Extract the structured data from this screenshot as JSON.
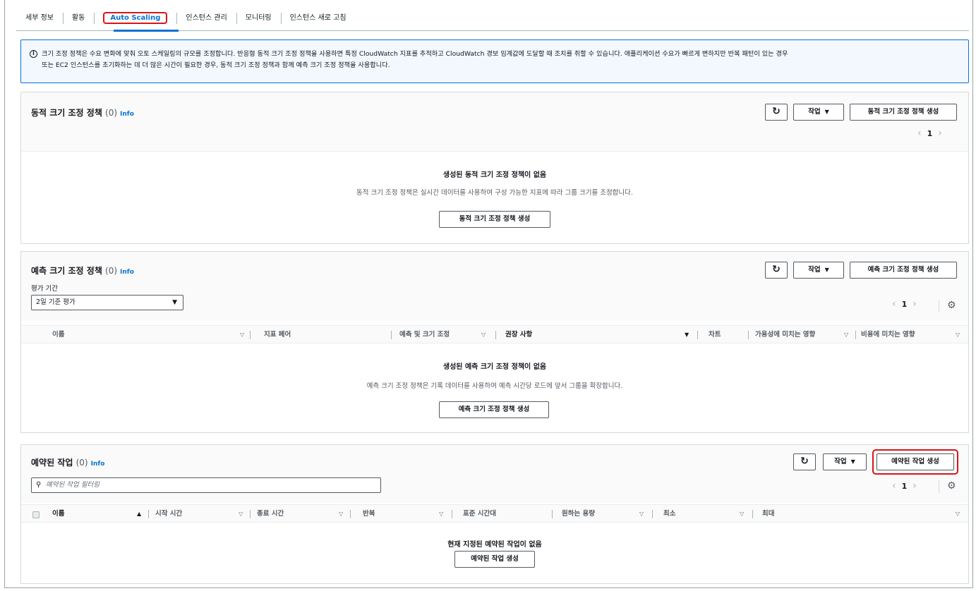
{
  "tabs": [
    {
      "label": "세부 정보"
    },
    {
      "label": "활동"
    },
    {
      "label": "Auto Scaling"
    },
    {
      "label": "인스턴스 관리"
    },
    {
      "label": "모니터링"
    },
    {
      "label": "인스턴스 새로 고침"
    }
  ],
  "alert": {
    "icon": "info-icon",
    "line1": "크기 조정 정책은 수요 변화에 맞춰 오토 스케일링의 규모를 조정합니다. 반응형 동적 크기 조정 정책을 사용하면 특정 CloudWatch 지표를 추적하고 CloudWatch 경보 임계값에 도달할 때 조치를 취할 수 있습니다. 애플리케이션 수요가 빠르게 변하지만 반복 패턴이 있는 경우",
    "line2": "또는 EC2 인스턴스를 초기화하는 데 더 많은 시간이 필요한 경우, 동적 크기 조정 정책과 함께 예측 크기 조정 정책을 사용합니다."
  },
  "dynamic": {
    "title": "동적 크기 조정 정책",
    "count": "(0)",
    "info": "Info",
    "refresh_icon": "↻",
    "actions_label": "작업",
    "create_label": "동적 크기 조정 정책 생성",
    "page": "1",
    "empty_title": "생성된 동적 크기 조정 정책이 없음",
    "empty_desc": "동적 크기 조정 정책은 실시간 데이터를 사용하여 구성 가능한 지표에 따라 그룹 크기를 조정합니다.",
    "empty_button": "동적 크기 조정 정책 생성"
  },
  "predictive": {
    "title": "예측 크기 조정 정책",
    "count": "(0)",
    "info": "Info",
    "refresh_icon": "↻",
    "actions_label": "작업",
    "create_label": "예측 크기 조정 정책 생성",
    "eval_label": "평가 기간",
    "eval_value": "2일 기준 평가",
    "page": "1",
    "columns": [
      "이름",
      "지표 페어",
      "예측 및 크기 조정",
      "권장 사항",
      "차트",
      "가용성에 미치는 영향",
      "비용에 미치는 영향"
    ],
    "empty_title": "생성된 예측 크기 조정 정책이 없음",
    "empty_desc": "예측 크기 조정 정책은 기록 데이터를 사용하여 예측 시간당 로드에 앞서 그룹을 확장합니다.",
    "empty_button": "예측 크기 조정 정책 생성"
  },
  "scheduled": {
    "title": "예약된 작업",
    "count": "(0)",
    "info": "Info",
    "refresh_icon": "↻",
    "actions_label": "작업",
    "create_label": "예약된 작업 생성",
    "filter_placeholder": "예약된 작업 필터링",
    "page": "1",
    "columns": [
      "이름",
      "시작 시간",
      "종료 시간",
      "반복",
      "표준 시간대",
      "원하는 용량",
      "최소",
      "최대"
    ],
    "empty_title": "현재 지정된 예약된 작업이 없음",
    "empty_button": "예약된 작업 생성"
  }
}
